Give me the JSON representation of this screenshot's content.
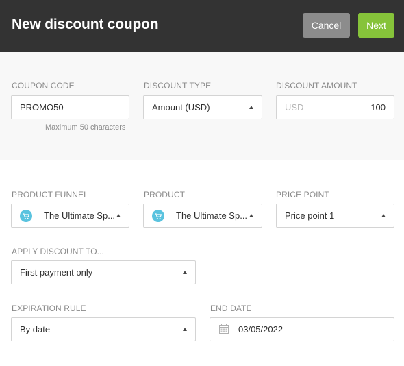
{
  "header": {
    "title": "New discount coupon",
    "cancel_label": "Cancel",
    "next_label": "Next"
  },
  "coupon_code": {
    "label": "COUPON CODE",
    "value": "PROMO50",
    "hint": "Maximum 50 characters"
  },
  "discount_type": {
    "label": "DISCOUNT TYPE",
    "value": "Amount (USD)"
  },
  "discount_amount": {
    "label": "DISCOUNT AMOUNT",
    "currency": "USD",
    "value": "100"
  },
  "product_funnel": {
    "label": "PRODUCT FUNNEL",
    "value": "The Ultimate Sp...",
    "icon": "shopping-cart-icon"
  },
  "product": {
    "label": "PRODUCT",
    "value": "The Ultimate Sp...",
    "icon": "shopping-cart-icon"
  },
  "price_point": {
    "label": "PRICE POINT",
    "value": "Price point 1"
  },
  "apply_discount": {
    "label": "APPLY DISCOUNT TO...",
    "value": "First payment only"
  },
  "expiration_rule": {
    "label": "EXPIRATION RULE",
    "value": "By date"
  },
  "end_date": {
    "label": "END DATE",
    "value": "03/05/2022",
    "icon": "calendar-icon"
  },
  "colors": {
    "header_bg": "#333333",
    "cancel_bg": "#8c8c8c",
    "next_bg": "#86c33a",
    "cart_icon_bg": "#5ac3df"
  }
}
